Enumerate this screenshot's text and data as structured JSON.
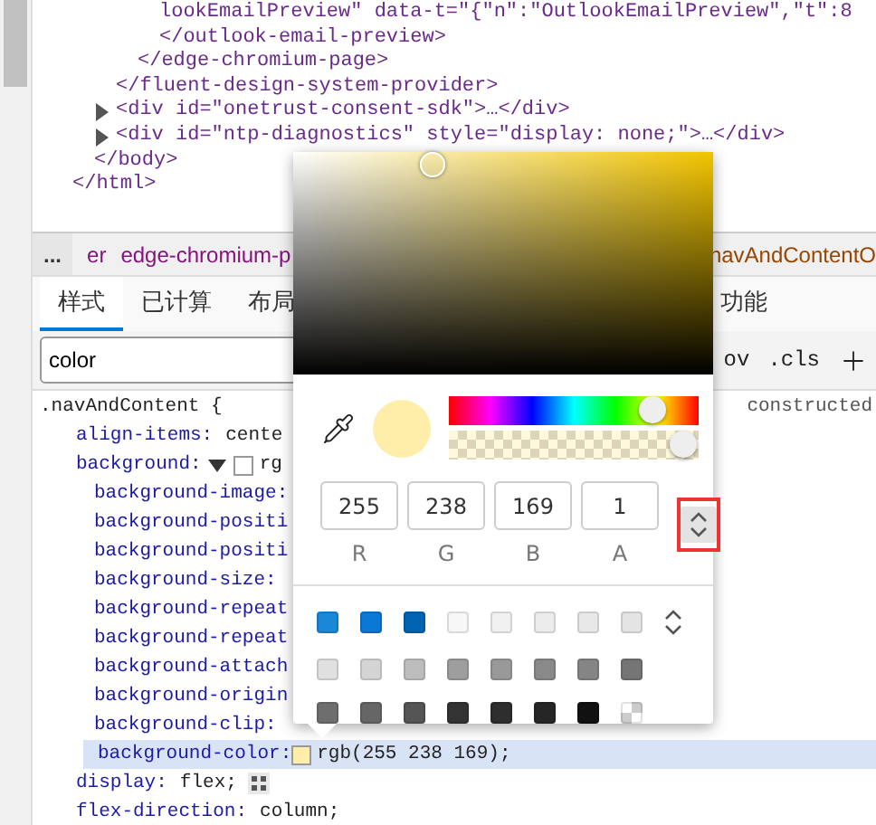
{
  "elements_tree": [
    {
      "close": "</html>",
      "children": [
        {
          "close": "</body>",
          "children": [
            {
              "close": "</fluent-design-system-provider>",
              "children": [
                {
                  "close": "</edge-chromium-page>",
                  "children": [
                    {
                      "text": "lookEmailPreview\" data-t=\"{\"n\":\"OutlookEmailPreview\",\"t\":8",
                      "close": "</outlook-email-preview>"
                    }
                  ]
                }
              ]
            },
            {
              "text": "<div id=\"onetrust-consent-sdk\">…</div>",
              "expanded": false
            },
            {
              "text": "<div id=\"ntp-diagnostics\" style=\"display: none;\">…</div>",
              "expanded": false
            }
          ]
        }
      ]
    }
  ],
  "breadcrumbs": {
    "overflow": "...",
    "items": [
      {
        "text": "er"
      },
      {
        "text": "edge-chromium-p"
      },
      {
        "text": "navAndContentO"
      }
    ]
  },
  "tabs": [
    {
      "label": "样式",
      "selected": true
    },
    {
      "label": "已计算",
      "selected": false
    },
    {
      "label": "布局",
      "selected": false
    },
    {
      "label": "功能",
      "selected": false
    }
  ],
  "filter": {
    "value": "color",
    "hov": "ov",
    "cls": ".cls"
  },
  "rule": {
    "selector": ".navAndContent {",
    "source": "constructed",
    "declarations": [
      {
        "prop": "align-items:",
        "value": "cente"
      },
      {
        "prop": "background:",
        "value": "rg",
        "expanded": true,
        "color": "#ffffff",
        "children": [
          {
            "prop": "background-image:",
            "highlighted": false
          },
          {
            "prop": "background-positi",
            "highlighted": false
          },
          {
            "prop": "background-positi",
            "highlighted": false
          },
          {
            "prop": "background-size:",
            "highlighted": false
          },
          {
            "prop": "background-repeat",
            "highlighted": false
          },
          {
            "prop": "background-repeat",
            "highlighted": false
          },
          {
            "prop": "background-attach",
            "highlighted": false
          },
          {
            "prop": "background-origin",
            "highlighted": false
          },
          {
            "prop": "background-clip:",
            "highlighted": false
          },
          {
            "prop": "background-color:",
            "value": "rgb(255 238 169);",
            "color": "#ffeea9",
            "highlighted": true
          }
        ]
      },
      {
        "prop": "display:",
        "value": "flex;",
        "editor": true
      },
      {
        "prop": "flex-direction:",
        "value": "column;"
      }
    ]
  },
  "color_picker": {
    "color": "#ffeea9",
    "hue": {
      "level": 0.86
    },
    "alpha": {
      "level": 1
    },
    "channels": [
      {
        "value": "255",
        "label": "R"
      },
      {
        "value": "238",
        "label": "G"
      },
      {
        "value": "169",
        "label": "B"
      },
      {
        "value": "1",
        "label": "A"
      }
    ],
    "format_toggle": {
      "highlighted": true
    },
    "palette": [
      {
        "color": "#1a87d8",
        "kind": "solid"
      },
      {
        "color": "#0a78d4",
        "kind": "solid"
      },
      {
        "color": "#0063b1",
        "kind": "solid"
      },
      {
        "color": "#f7f7f7",
        "kind": "solid"
      },
      {
        "color": "#f0f0f0",
        "kind": "solid"
      },
      {
        "color": "#ececec",
        "kind": "solid"
      },
      {
        "color": "#e8e8e8",
        "kind": "solid"
      },
      {
        "color": "#e4e4e4",
        "kind": "solid"
      },
      {
        "color": "#e0e0e0",
        "kind": "solid"
      },
      {
        "color": "#d4d4d4",
        "kind": "solid"
      },
      {
        "color": "#bdbdbd",
        "kind": "solid"
      },
      {
        "color": "#9e9e9e",
        "kind": "solid"
      },
      {
        "color": "#999999",
        "kind": "solid"
      },
      {
        "color": "#8a8a8a",
        "kind": "solid"
      },
      {
        "color": "#858585",
        "kind": "solid"
      },
      {
        "color": "#757575",
        "kind": "solid"
      },
      {
        "color": "#6e6e6e",
        "kind": "solid"
      },
      {
        "color": "#666666",
        "kind": "solid"
      },
      {
        "color": "#555555",
        "kind": "solid"
      },
      {
        "color": "#333333",
        "kind": "solid"
      },
      {
        "color": "#2e2e2e",
        "kind": "solid"
      },
      {
        "color": "#262626",
        "kind": "solid"
      },
      {
        "color": "#111111",
        "kind": "solid"
      },
      {
        "kind": "transparent"
      }
    ]
  }
}
